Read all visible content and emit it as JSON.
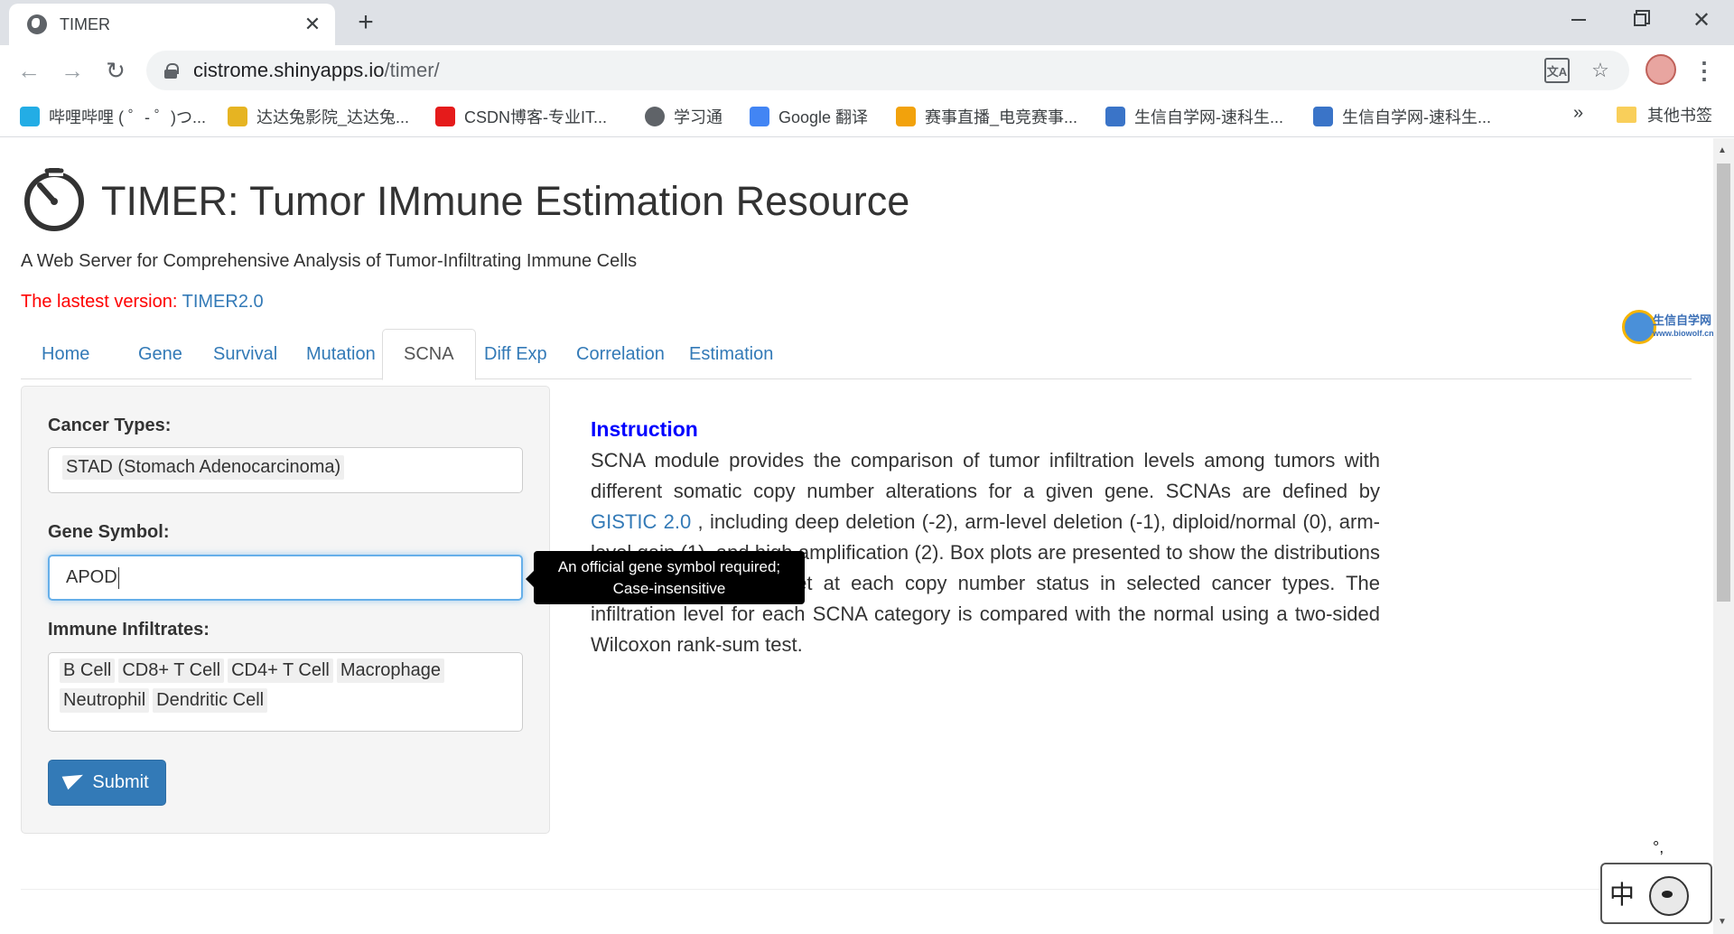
{
  "browser": {
    "tab_title": "TIMER",
    "tab_close": "✕",
    "new_tab": "+",
    "url_host": "cistrome.shinyapps.io",
    "url_path": "/timer/",
    "bookmarks": [
      {
        "label": "哔哩哔哩 ( ゜- ゜)つ...",
        "icon": "bilibili-icon",
        "color": "#23ade5"
      },
      {
        "label": "达达兔影院_达达兔...",
        "icon": "dadatu-icon",
        "color": "#e6b422"
      },
      {
        "label": "CSDN博客-专业IT...",
        "icon": "csdn-icon",
        "color": "#e51b1b"
      },
      {
        "label": "学习通",
        "icon": "globe-icon",
        "color": "#5f6368"
      },
      {
        "label": "Google 翻译",
        "icon": "google-translate-icon",
        "color": "#4285f4"
      },
      {
        "label": "赛事直播_电竞赛事...",
        "icon": "esports-icon",
        "color": "#f2a20c"
      },
      {
        "label": "生信自学网-速科生...",
        "icon": "biowolf-icon",
        "color": "#3a74c8"
      },
      {
        "label": "生信自学网-速科生...",
        "icon": "biowolf-icon",
        "color": "#3a74c8"
      }
    ],
    "bookmarks_more": "»",
    "other_bookmarks": "其他书签"
  },
  "site": {
    "title": "TIMER: Tumor IMmune Estimation Resource",
    "subtitle": "A Web Server for Comprehensive Analysis of Tumor-Infiltrating Immune Cells",
    "version_prefix": "The lastest version: ",
    "version_link": "TIMER2.0"
  },
  "tabs": [
    {
      "label": "Home",
      "active": false
    },
    {
      "label": "Gene",
      "active": false
    },
    {
      "label": "Survival",
      "active": false
    },
    {
      "label": "Mutation",
      "active": false
    },
    {
      "label": "SCNA",
      "active": true
    },
    {
      "label": "Diff Exp",
      "active": false
    },
    {
      "label": "Correlation",
      "active": false
    },
    {
      "label": "Estimation",
      "active": false
    }
  ],
  "form": {
    "cancer_label": "Cancer Types:",
    "cancer_value": "STAD (Stomach Adenocarcinoma)",
    "gene_label": "Gene Symbol:",
    "gene_value": "APOD",
    "immune_label": "Immune Infiltrates:",
    "immune_values": [
      "B Cell",
      "CD8+ T Cell",
      "CD4+ T Cell",
      "Macrophage",
      "Neutrophil",
      "Dendritic Cell"
    ],
    "submit_label": "Submit"
  },
  "tooltip": {
    "line1": "An official gene symbol required;",
    "line2": "Case-insensitive"
  },
  "instruction": {
    "title": "Instruction",
    "text_before": "SCNA module provides the comparison of tumor infiltration levels among tumors with different somatic copy number alterations for a given gene. SCNAs are defined by ",
    "link": "GISTIC 2.0",
    "text_after": " , including deep deletion (-2), arm-level deletion (-1), diploid/normal (0), arm-level gain (1), and high amplification (2). Box plots are presented to show the distributions of each immune subset at each copy number status in selected cancer types. The infiltration level for each SCNA category is compared with the normal using a two-sided Wilcoxon rank-sum test."
  },
  "watermark": {
    "line1": "生信自学网",
    "line2": "www.biowolf.cn"
  },
  "ime": {
    "char": "中",
    "mark": "°,"
  }
}
